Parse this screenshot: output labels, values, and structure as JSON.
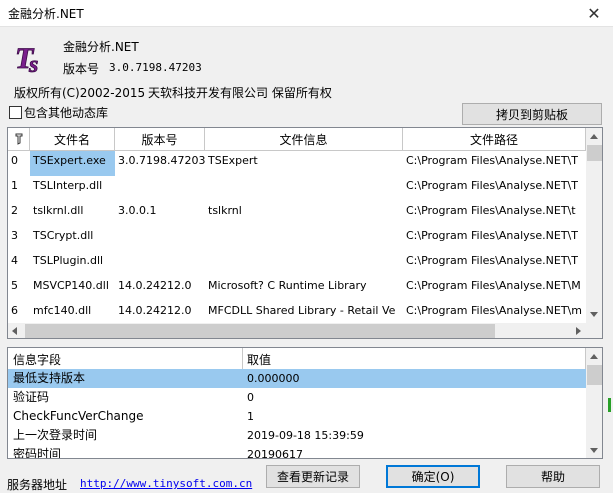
{
  "window": {
    "title": "金融分析.NET"
  },
  "app": {
    "name": "金融分析.NET",
    "version_label": "版本号",
    "version_value": "3.0.7198.47203",
    "copyright": "版权所有(C)2002-2015",
    "company": "天软科技开发有限公司 保留所有权"
  },
  "options": {
    "include_dynamic_libs_label": "包含其他动态库",
    "copy_button": "拷贝到剪贴板"
  },
  "files_table": {
    "headers": [
      "文件名",
      "版本号",
      "文件信息",
      "文件路径"
    ],
    "rows": [
      {
        "index": "0",
        "name": "TSExpert.exe",
        "version": "3.0.7198.47203",
        "info": "TSExpert",
        "path": "C:\\Program Files\\Analyse.NET\\T"
      },
      {
        "index": "1",
        "name": "TSLInterp.dll",
        "version": "",
        "info": "",
        "path": "C:\\Program Files\\Analyse.NET\\T"
      },
      {
        "index": "2",
        "name": "tslkrnl.dll",
        "version": "3.0.0.1",
        "info": "tslkrnl",
        "path": "C:\\Program Files\\Analyse.NET\\t"
      },
      {
        "index": "3",
        "name": "TSCrypt.dll",
        "version": "",
        "info": "",
        "path": "C:\\Program Files\\Analyse.NET\\T"
      },
      {
        "index": "4",
        "name": "TSLPlugin.dll",
        "version": "",
        "info": "",
        "path": "C:\\Program Files\\Analyse.NET\\T"
      },
      {
        "index": "5",
        "name": "MSVCP140.dll",
        "version": "14.0.24212.0",
        "info": "Microsoft? C Runtime Library",
        "path": "C:\\Program Files\\Analyse.NET\\M"
      },
      {
        "index": "6",
        "name": "mfc140.dll",
        "version": "14.0.24212.0",
        "info": "MFCDLL Shared Library - Retail Ve",
        "path": "C:\\Program Files\\Analyse.NET\\m"
      }
    ]
  },
  "info_table": {
    "headers": [
      "信息字段",
      "取值"
    ],
    "rows": [
      {
        "field": "最低支持版本",
        "value": "0.000000"
      },
      {
        "field": "验证码",
        "value": "0"
      },
      {
        "field": "CheckFuncVerChange",
        "value": "1"
      },
      {
        "field": "上一次登录时间",
        "value": "2019-09-18 15:39:59"
      },
      {
        "field": "密码时间",
        "value": "20190617"
      }
    ]
  },
  "footer": {
    "server_label": "服务器地址",
    "server_url": "http://www.tinysoft.com.cn",
    "changelog_button": "查看更新记录",
    "ok_button": "确定(O)",
    "help_button": "帮助"
  },
  "colors": {
    "selection": "#99c9ef",
    "accent": "#0078d7",
    "logo": "#7a1f8c"
  }
}
